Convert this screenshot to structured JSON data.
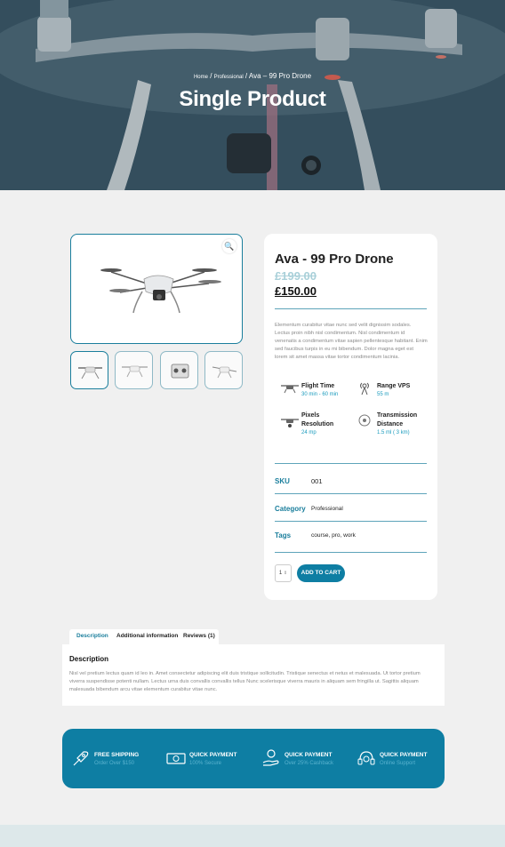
{
  "hero": {
    "breadcrumb": {
      "home": "Home",
      "sep1": " / ",
      "category": "Professional",
      "sep2": " / ",
      "current": "Ava – 99 Pro Drone"
    },
    "title": "Single Product"
  },
  "gallery": {
    "zoom_icon": "search-icon",
    "thumbnails": [
      "drone-front",
      "drone-side",
      "remote-controller",
      "drone-top"
    ]
  },
  "product": {
    "title": "Ava - 99 Pro Drone",
    "old_price": "£199.00",
    "price": "£150.00",
    "description": "Elementum curabitur vitae nunc sed velit dignissim sodales. Lectus proin nibh nisl condimentum. Nisl condimentum id venenatis a condimentum vitae sapien pellentesque habitant. Enim sed faucibus turpis in eu mi bibendum. Dolor magna eget est lorem sit amet massa vitae tortor condimentum lacinia.",
    "features": [
      {
        "icon": "drone-icon",
        "title": "Flight Time",
        "value": "30 min - 60 min"
      },
      {
        "icon": "signal-tower-icon",
        "title": "Range VPS",
        "value": "55 m"
      },
      {
        "icon": "drone-camera-icon",
        "title": "Pixels Resolution",
        "value": "24 mp"
      },
      {
        "icon": "transmission-icon",
        "title": "Transmission Distance",
        "value": "1.5 ml ( 3 km)"
      }
    ],
    "meta": {
      "sku_label": "SKU",
      "sku": "001",
      "category_label": "Category",
      "category": "Professional",
      "tags_label": "Tags",
      "tags": "course, pro, work"
    },
    "quantity": "1",
    "add_to_cart": "ADD TO CART"
  },
  "tabs": {
    "items": [
      "Description",
      "Additional information",
      "Reviews (1)"
    ],
    "active": "Description",
    "panel_title": "Description",
    "panel_text": "Nisl vel pretium lectus quam id leo in. Amet consectetur adipiscing elit duis tristique sollicitudin. Tristique senectus et netus et malesuada. Ut tortor pretium viverra suspendisse potenti nullam. Lectus urna duis convallis convallis tellus Nunc scelerisque viverra mauris in aliquam sem fringilla ut. Sagittis aliquam malesuada bibendum arcu vitae elementum curabitur vitae nunc."
  },
  "feature_bar": [
    {
      "icon": "rocket-icon",
      "title": "FREE SHIPPING",
      "subtitle": "Order Over $150"
    },
    {
      "icon": "money-icon",
      "title": "QUICK PAYMENT",
      "subtitle": "100% Secure"
    },
    {
      "icon": "hand-coin-icon",
      "title": "QUICK PAYMENT",
      "subtitle": "Over 25% Cashback"
    },
    {
      "icon": "headset-icon",
      "title": "QUICK PAYMENT",
      "subtitle": "Online Support"
    }
  ],
  "colors": {
    "accent": "#0e7ea3",
    "accent_light": "#1a9bbd",
    "page_bg": "#f0f0f0",
    "old_price": "#a9d0d9"
  }
}
